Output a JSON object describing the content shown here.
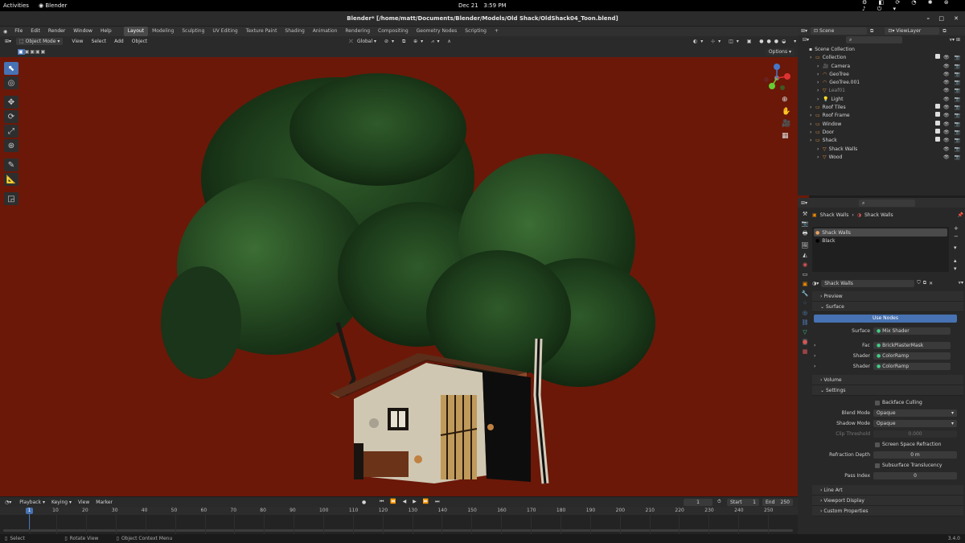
{
  "system_bar": {
    "activities": "Activities",
    "app": "Blender",
    "date": "Dec 21",
    "time": "3:59 PM"
  },
  "window": {
    "title": "Blender* [/home/matt/Documents/Blender/Models/Old Shack/OldShack04_Toon.blend]"
  },
  "menu": {
    "items": [
      "File",
      "Edit",
      "Render",
      "Window",
      "Help"
    ]
  },
  "workspaces": [
    "Layout",
    "Modeling",
    "Sculpting",
    "UV Editing",
    "Texture Paint",
    "Shading",
    "Animation",
    "Rendering",
    "Compositing",
    "Geometry Nodes",
    "Scripting"
  ],
  "workspace_add": "+",
  "viewport_header": {
    "mode": "Object Mode",
    "items": [
      "View",
      "Select",
      "Add",
      "Object"
    ],
    "orientation": "Global",
    "options": "Options"
  },
  "outliner": {
    "scene": "Scene",
    "view_layer": "ViewLayer",
    "root": "Scene Collection",
    "items": [
      {
        "label": "Collection",
        "indent": 1
      },
      {
        "label": "Camera",
        "indent": 2
      },
      {
        "label": "GeoTree",
        "indent": 2
      },
      {
        "label": "GeoTree.001",
        "indent": 2
      },
      {
        "label": "Leaf01",
        "indent": 2,
        "dim": true
      },
      {
        "label": "Light",
        "indent": 2
      },
      {
        "label": "Roof Tiles",
        "indent": 1
      },
      {
        "label": "Roof Frame",
        "indent": 1
      },
      {
        "label": "Window",
        "indent": 1
      },
      {
        "label": "Door",
        "indent": 1
      },
      {
        "label": "Shack",
        "indent": 1
      },
      {
        "label": "Shack Walls",
        "indent": 2
      },
      {
        "label": "Wood",
        "indent": 2
      }
    ]
  },
  "properties": {
    "breadcrumb_object": "Shack Walls",
    "breadcrumb_material": "Shack Walls",
    "slots": [
      "Shack Walls",
      "Black"
    ],
    "material_name": "Shack Walls",
    "panels": {
      "preview": "Preview",
      "surface": "Surface",
      "volume": "Volume",
      "settings": "Settings",
      "line_art": "Line Art",
      "viewport_display": "Viewport Display",
      "custom_properties": "Custom Properties"
    },
    "use_nodes": "Use Nodes",
    "surface_rows": [
      {
        "label": "Surface",
        "value": "Mix Shader"
      },
      {
        "label": "Fac",
        "value": "BrickPlasterMask"
      },
      {
        "label": "Shader",
        "value": "ColorRamp"
      },
      {
        "label": "Shader",
        "value": "ColorRamp"
      }
    ],
    "backface_culling": "Backface Culling",
    "blend_mode_label": "Blend Mode",
    "blend_mode": "Opaque",
    "shadow_mode_label": "Shadow Mode",
    "shadow_mode": "Opaque",
    "clip_threshold_label": "Clip Threshold",
    "clip_threshold": "0.000",
    "ssr": "Screen Space Refraction",
    "refraction_depth_label": "Refraction Depth",
    "refraction_depth": "0 m",
    "subsurface": "Subsurface Translucency",
    "pass_index_label": "Pass Index",
    "pass_index": "0"
  },
  "timeline": {
    "menus": [
      "Playback",
      "Keying",
      "View",
      "Marker"
    ],
    "current_frame": "1",
    "start_label": "Start",
    "start": "1",
    "end_label": "End",
    "end": "250",
    "ticks": [
      "1",
      "10",
      "20",
      "30",
      "40",
      "50",
      "60",
      "70",
      "80",
      "90",
      "100",
      "110",
      "120",
      "130",
      "140",
      "150",
      "160",
      "170",
      "180",
      "190",
      "200",
      "210",
      "220",
      "230",
      "240",
      "250"
    ],
    "playhead_label": "1"
  },
  "status_bar": {
    "select": "Select",
    "rotate": "Rotate View",
    "context": "Object Context Menu",
    "version": "3.4.0"
  },
  "colors": {
    "viewport_bg": "#6b1808",
    "accent": "#4772b3"
  }
}
